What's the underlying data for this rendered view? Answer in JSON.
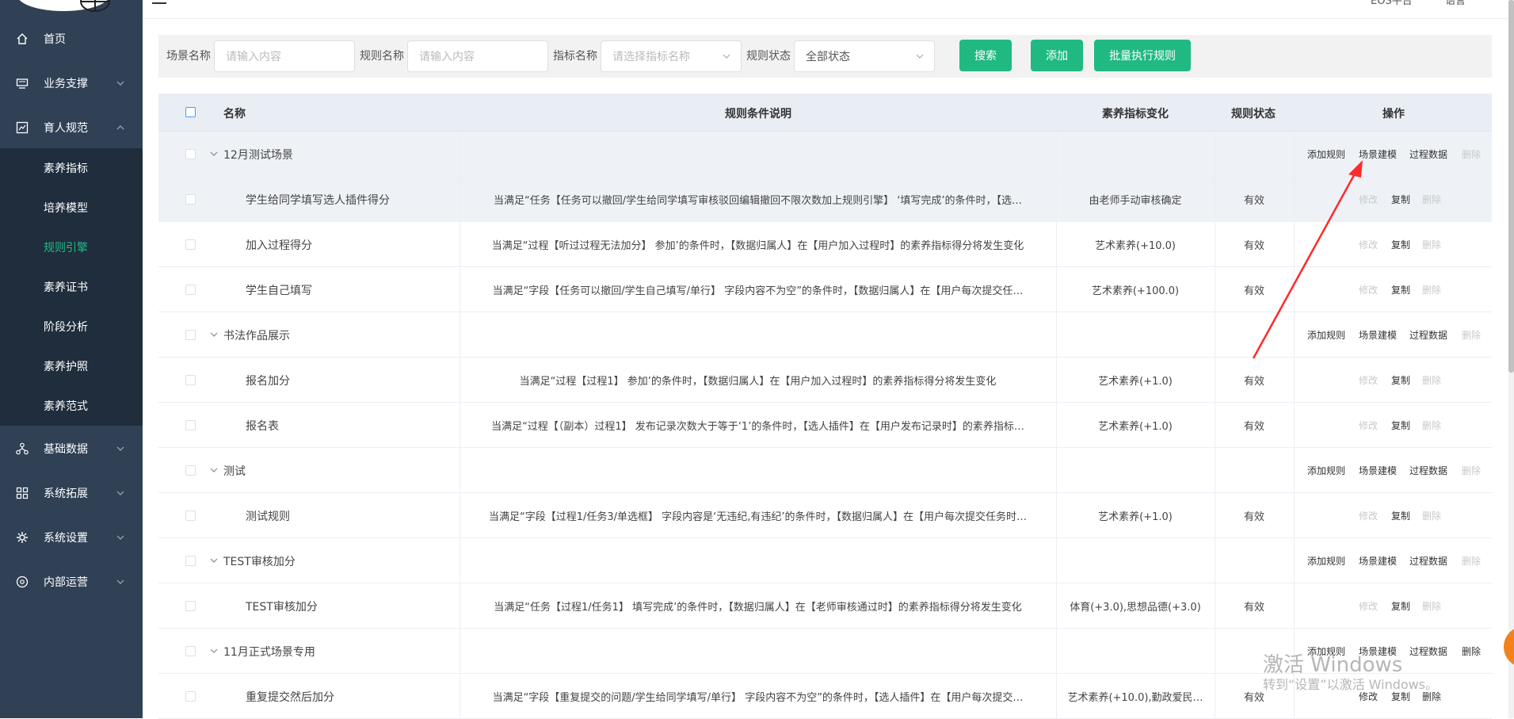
{
  "topbar": {
    "platform_label": "EOS平台",
    "language_label": "语言"
  },
  "sidebar": {
    "items": [
      {
        "label": "首页",
        "icon": "home-icon"
      },
      {
        "label": "业务支撑",
        "icon": "monitor-icon"
      },
      {
        "label": "育人规范",
        "icon": "chart-icon"
      },
      {
        "label": "基础数据",
        "icon": "org-icon"
      },
      {
        "label": "系统拓展",
        "icon": "grid-icon"
      },
      {
        "label": "系统设置",
        "icon": "tools-icon"
      },
      {
        "label": "内部运营",
        "icon": "gauge-icon"
      }
    ],
    "subitems": [
      {
        "label": "素养指标"
      },
      {
        "label": "培养模型"
      },
      {
        "label": "规则引擎"
      },
      {
        "label": "素养证书"
      },
      {
        "label": "阶段分析"
      },
      {
        "label": "素养护照"
      },
      {
        "label": "素养范式"
      }
    ],
    "active_sub": "规则引擎",
    "active_color": "#21b982"
  },
  "filters": {
    "scene_label": "场景名称",
    "scene_placeholder": "请输入内容",
    "rule_label": "规则名称",
    "rule_placeholder": "请输入内容",
    "indicator_label": "指标名称",
    "indicator_placeholder": "请选择指标名称",
    "status_label": "规则状态",
    "status_value": "全部状态",
    "search_btn": "搜索",
    "add_btn": "添加",
    "batch_btn": "批量执行规则"
  },
  "table": {
    "headers": {
      "name": "名称",
      "condition": "规则条件说明",
      "change": "素养指标变化",
      "status": "规则状态",
      "ops": "操作"
    },
    "group_ops": {
      "add_rule": "添加规则",
      "scene_model": "场景建模",
      "process_data": "过程数据",
      "delete": "删除"
    },
    "rule_ops": {
      "edit": "修改",
      "copy": "复制",
      "delete": "删除"
    },
    "rows": [
      {
        "type": "group",
        "name": "12月测试场景"
      },
      {
        "type": "rule",
        "name": "学生给同学填写选人插件得分",
        "condition": "当满足“任务【任务可以撤回/学生给同学填写审核驳回编辑撤回不限次数加上规则引擎】 ‘填写完成’的条件时，【选…",
        "change": "由老师手动审核确定",
        "status": "有效"
      },
      {
        "type": "rule",
        "name": "加入过程得分",
        "condition": "当满足“过程【听过过程无法加分】 参加’的条件时，【数据归属人】在【用户加入过程时】的素养指标得分将发生变化",
        "change": "艺术素养(+10.0)",
        "status": "有效"
      },
      {
        "type": "rule",
        "name": "学生自己填写",
        "condition": "当满足“字段【任务可以撤回/学生自己填写/单行】 字段内容不为空”的条件时，【数据归属人】在【用户每次提交任…",
        "change": "艺术素养(+100.0)",
        "status": "有效"
      },
      {
        "type": "group",
        "name": "书法作品展示"
      },
      {
        "type": "rule",
        "name": "报名加分",
        "condition": "当满足“过程【过程1】 参加’的条件时，【数据归属人】在【用户加入过程时】的素养指标得分将发生变化",
        "change": "艺术素养(+1.0)",
        "status": "有效"
      },
      {
        "type": "rule",
        "name": "报名表",
        "condition": "当满足“过程【（副本）过程1】 发布记录次数大于等于‘1’的条件时，【选人插件】在【用户发布记录时】的素养指标…",
        "change": "艺术素养(+1.0)",
        "status": "有效"
      },
      {
        "type": "group",
        "name": "测试"
      },
      {
        "type": "rule",
        "name": "测试规则",
        "condition": "当满足“字段【过程1/任务3/单选框】 字段内容是‘无违纪,有违纪’的条件时，【数据归属人】在【用户每次提交任务时…",
        "change": "艺术素养(+1.0)",
        "status": "有效"
      },
      {
        "type": "group",
        "name": "TEST审核加分"
      },
      {
        "type": "rule",
        "name": "TEST审核加分",
        "condition": "当满足“任务【过程1/任务1】 填写完成’的条件时，【数据归属人】在【老师审核通过时】的素养指标得分将发生变化",
        "change": "体育(+3.0),思想品德(+3.0)",
        "status": "有效"
      },
      {
        "type": "group",
        "name": "11月正式场景专用"
      },
      {
        "type": "rule",
        "name": "重复提交然后加分",
        "condition": "当满足“字段【重复提交的问题/学生给同学填写/单行】 字段内容不为空”的条件时，【选人插件】在【用户每次提交…",
        "change": "艺术素养(+10.0),勤政爱民…",
        "status": "有效"
      }
    ]
  },
  "watermark": {
    "line1": "激活 Windows",
    "line2": "转到“设置”以激活 Windows。"
  },
  "colors": {
    "accent": "#21b982",
    "sidebar_bg": "#304156",
    "submenu_bg": "#1f2d3d",
    "annotation_arrow": "#ff2a2a"
  }
}
